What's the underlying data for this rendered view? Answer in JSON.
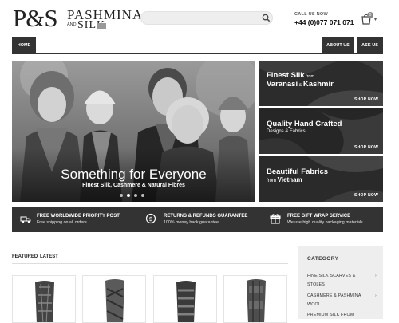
{
  "header": {
    "logo_ps": "P&S",
    "logo_pashmina": "PASHMINA",
    "logo_and": "AND",
    "logo_silk": "SILK",
    "search_placeholder": "",
    "call_label": "CALL US NOW",
    "call_number": "+44 (0)077 071 071",
    "cart_count": "0"
  },
  "nav": {
    "home": "HOME",
    "about": "ABOUT US",
    "ask": "ASK US"
  },
  "hero": {
    "title": "Something for Everyone",
    "subtitle": "Finest Silk, Cashmere & Natural Fibres",
    "dots": 4,
    "active_dot": 1
  },
  "promos": [
    {
      "line1": "Finest Silk",
      "line1_small": " from",
      "line2": "Varanasi",
      "amp": " & ",
      "line2b": "Kashmir",
      "shop": "SHOP NOW"
    },
    {
      "line1": "Quality Hand Crafted",
      "line2": "Designs & Fabrics",
      "shop": "SHOP NOW"
    },
    {
      "line1": "Beautiful Fabrics",
      "line2": "from",
      "line2b": "Vietnam",
      "shop": "SHOP NOW"
    }
  ],
  "features": [
    {
      "icon": "truck-icon",
      "title": "FREE WORLDWIDE PRIORITY POST",
      "sub": "Free shipping on all orders."
    },
    {
      "icon": "refund-icon",
      "title": "RETURNS & REFUNDS GUARANTEE",
      "sub": "100% money back guarantee."
    },
    {
      "icon": "gift-icon",
      "title": "FREE GIFT WRAP SERVICE",
      "sub": "We use high quality packaging materials."
    }
  ],
  "tabs": {
    "featured": "FEATURED",
    "latest": "LATEST"
  },
  "category": {
    "heading": "CATEGORY",
    "items": [
      {
        "line1": "FINE SILK SCARVES &",
        "line2": "STOLES"
      },
      {
        "line1": "CASHMERE & PASHMINA",
        "line2": "WOOL"
      },
      {
        "line1": "PREMIUM SILK FROM",
        "line2": ""
      }
    ]
  },
  "colors": {
    "dark": "#333333",
    "sidebar_bg": "#eeeeee",
    "muted_text": "#555555"
  }
}
